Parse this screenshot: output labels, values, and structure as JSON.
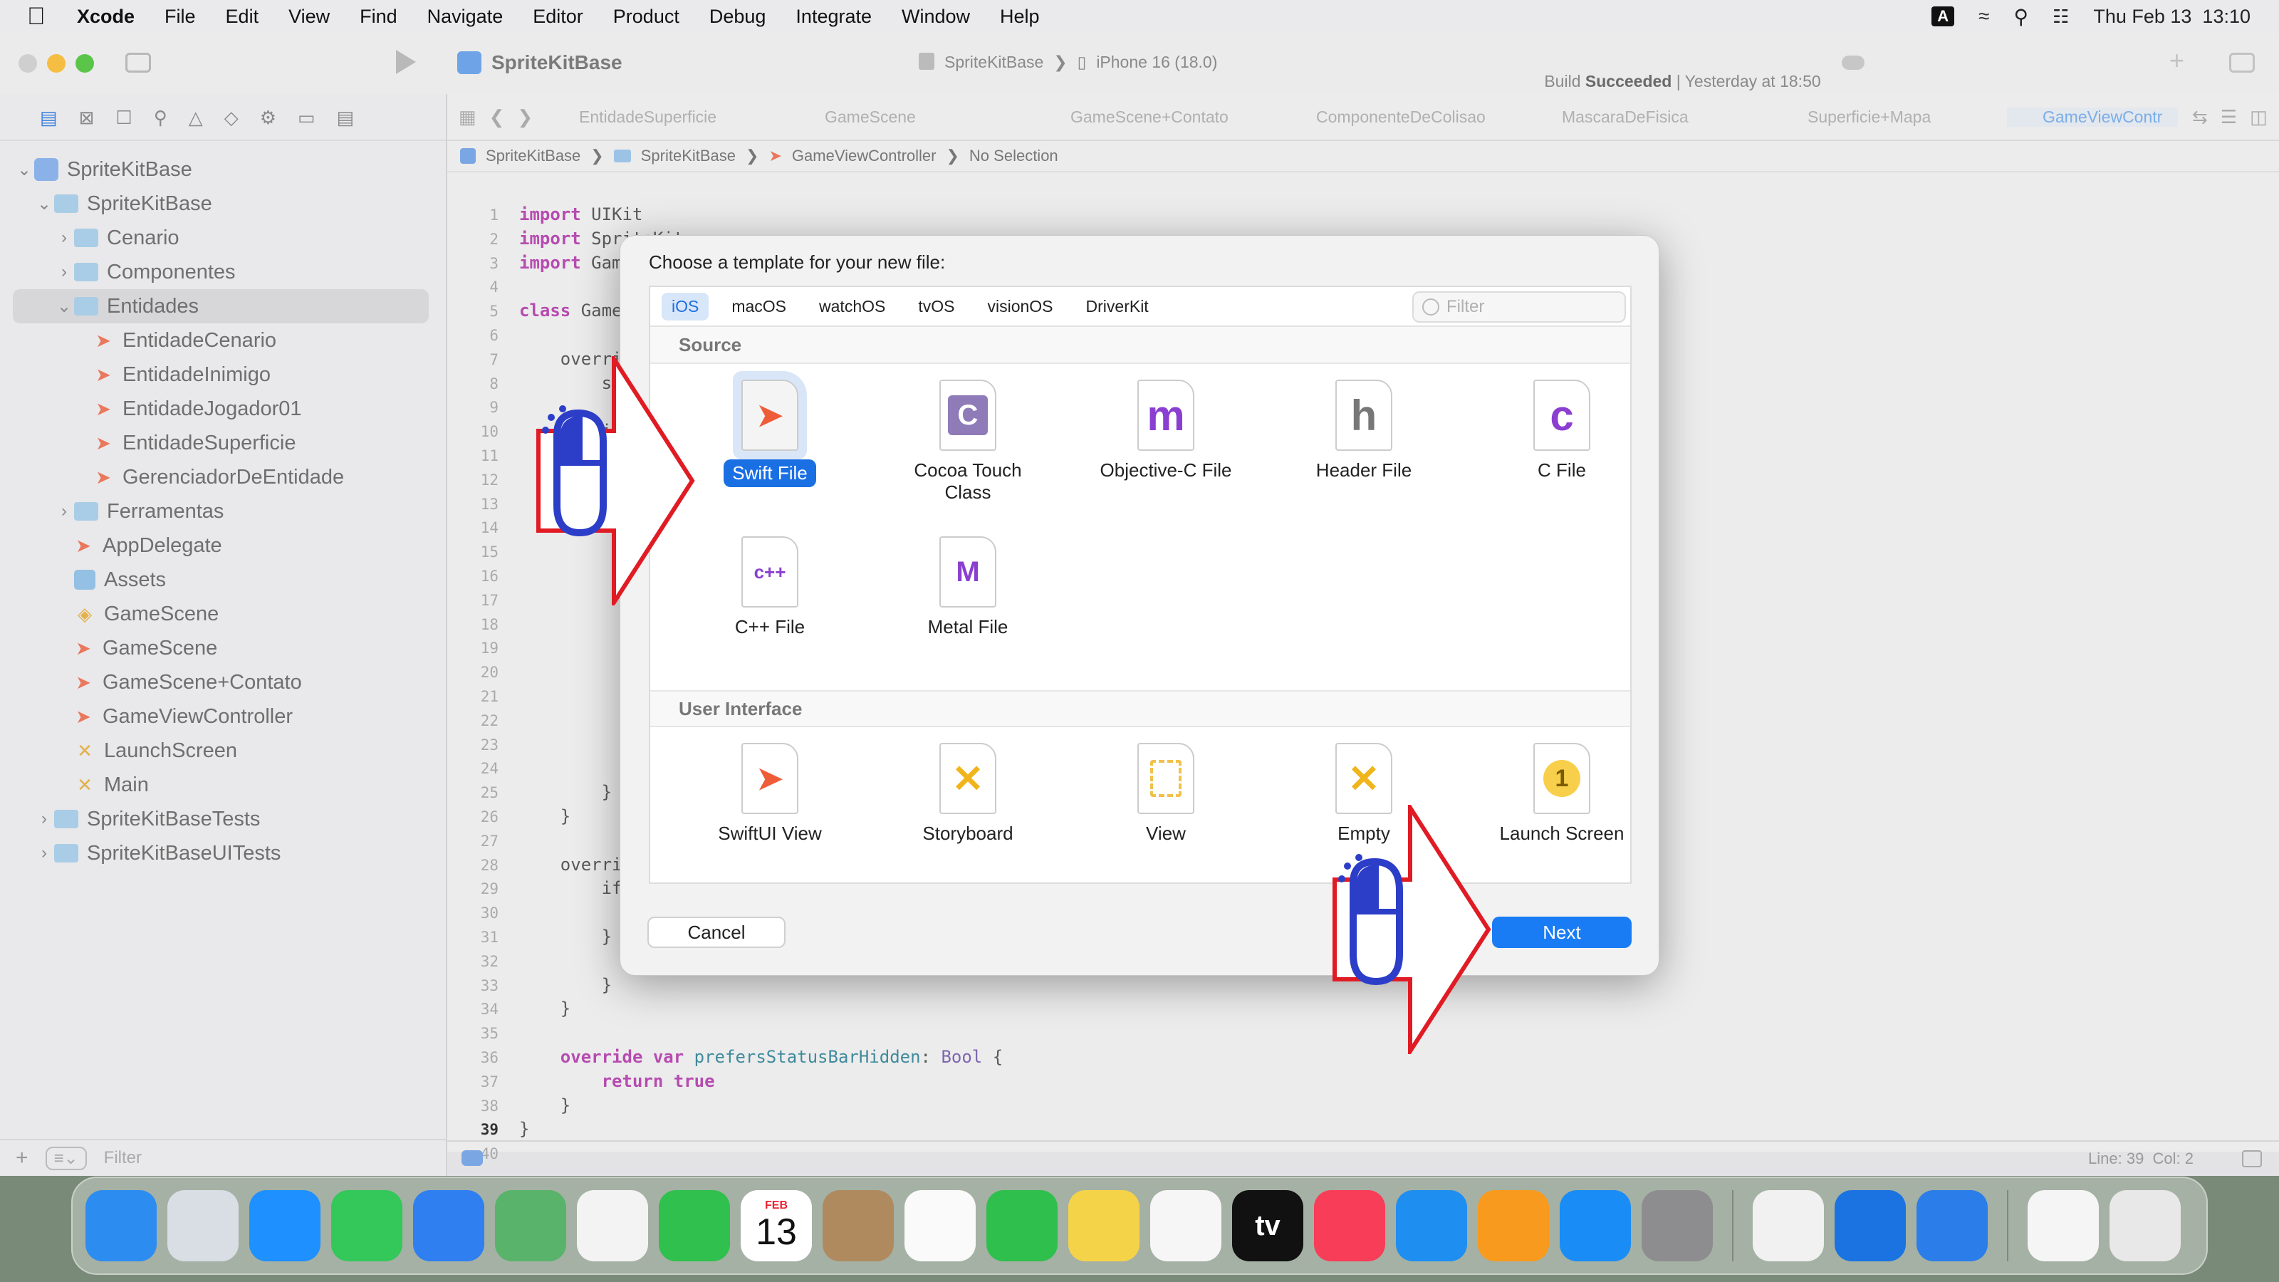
{
  "menubar": {
    "app": "Xcode",
    "items": [
      "File",
      "Edit",
      "View",
      "Find",
      "Navigate",
      "Editor",
      "Product",
      "Debug",
      "Integrate",
      "Window",
      "Help"
    ],
    "input_indicator": "A",
    "clock": "Thu Feb 13  13:10"
  },
  "toolbar": {
    "project": "SpriteKitBase",
    "scheme": "SpriteKitBase",
    "device": "iPhone 16 (18.0)",
    "status_prefix": "Build",
    "status_strong": "Succeeded",
    "status_time": "| Yesterday at 18:50"
  },
  "tabs": [
    "EntidadeSuperficie",
    "GameScene",
    "GameScene+Contato",
    "ComponenteDeColisao",
    "MascaraDeFisica",
    "Superficie+Mapa",
    "GameViewContr"
  ],
  "jumpbar": [
    "SpriteKitBase",
    "SpriteKitBase",
    "GameViewController",
    "No Selection"
  ],
  "navigator": {
    "items": [
      {
        "label": "SpriteKitBase",
        "indent": 0,
        "icon": "project",
        "chev": "⌄"
      },
      {
        "label": "SpriteKitBase",
        "indent": 1,
        "icon": "folder",
        "chev": "⌄"
      },
      {
        "label": "Cenario",
        "indent": 2,
        "icon": "folder",
        "chev": "›"
      },
      {
        "label": "Componentes",
        "indent": 2,
        "icon": "folder",
        "chev": "›"
      },
      {
        "label": "Entidades",
        "indent": 2,
        "icon": "folder",
        "chev": "⌄",
        "selected": true
      },
      {
        "label": "EntidadeCenario",
        "indent": 3,
        "icon": "swift"
      },
      {
        "label": "EntidadeInimigo",
        "indent": 3,
        "icon": "swift"
      },
      {
        "label": "EntidadeJogador01",
        "indent": 3,
        "icon": "swift"
      },
      {
        "label": "EntidadeSuperficie",
        "indent": 3,
        "icon": "swift"
      },
      {
        "label": "GerenciadorDeEntidade",
        "indent": 3,
        "icon": "swift"
      },
      {
        "label": "Ferramentas",
        "indent": 2,
        "icon": "folder",
        "chev": "›"
      },
      {
        "label": "AppDelegate",
        "indent": 2,
        "icon": "swift"
      },
      {
        "label": "Assets",
        "indent": 2,
        "icon": "assets"
      },
      {
        "label": "GameScene",
        "indent": 2,
        "icon": "scene"
      },
      {
        "label": "GameScene",
        "indent": 2,
        "icon": "swift"
      },
      {
        "label": "GameScene+Contato",
        "indent": 2,
        "icon": "swift"
      },
      {
        "label": "GameViewController",
        "indent": 2,
        "icon": "swift"
      },
      {
        "label": "LaunchScreen",
        "indent": 2,
        "icon": "storyboard"
      },
      {
        "label": "Main",
        "indent": 2,
        "icon": "storyboard"
      },
      {
        "label": "SpriteKitBaseTests",
        "indent": 1,
        "icon": "folder",
        "chev": "›"
      },
      {
        "label": "SpriteKitBaseUITests",
        "indent": 1,
        "icon": "folder",
        "chev": "›"
      }
    ],
    "filter_placeholder": "Filter"
  },
  "code": {
    "lines": [
      {
        "n": "1",
        "t": "import UIKit"
      },
      {
        "n": "2",
        "t": "import SpriteKit"
      },
      {
        "n": "3",
        "t": "import GameplayKit"
      },
      {
        "n": "4",
        "t": ""
      },
      {
        "n": "5",
        "t": "class Game"
      },
      {
        "n": "6",
        "t": ""
      },
      {
        "n": "7",
        "t": "    overri"
      },
      {
        "n": "8",
        "t": "        s"
      },
      {
        "n": "9",
        "t": ""
      },
      {
        "n": "10",
        "t": "        i"
      },
      {
        "n": "11",
        "t": ""
      },
      {
        "n": "12",
        "t": ""
      },
      {
        "n": "13",
        "t": ""
      },
      {
        "n": "14",
        "t": ""
      },
      {
        "n": "15",
        "t": ""
      },
      {
        "n": "16",
        "t": ""
      },
      {
        "n": "17",
        "t": ""
      },
      {
        "n": "18",
        "t": ""
      },
      {
        "n": "19",
        "t": ""
      },
      {
        "n": "20",
        "t": ""
      },
      {
        "n": "21",
        "t": ""
      },
      {
        "n": "22",
        "t": ""
      },
      {
        "n": "23",
        "t": ""
      },
      {
        "n": "24",
        "t": ""
      },
      {
        "n": "25",
        "t": "        }"
      },
      {
        "n": "26",
        "t": "    }"
      },
      {
        "n": "27",
        "t": ""
      },
      {
        "n": "28",
        "t": "    overri"
      },
      {
        "n": "29",
        "t": "        if"
      },
      {
        "n": "30",
        "t": ""
      },
      {
        "n": "31",
        "t": "        }"
      },
      {
        "n": "32",
        "t": ""
      },
      {
        "n": "33",
        "t": "        }"
      },
      {
        "n": "34",
        "t": "    }"
      },
      {
        "n": "35",
        "t": ""
      },
      {
        "n": "36",
        "t": "    override var prefersStatusBarHidden: Bool {"
      },
      {
        "n": "37",
        "t": "        return true"
      },
      {
        "n": "38",
        "t": "    }"
      },
      {
        "n": "39",
        "t": "}"
      },
      {
        "n": "40",
        "t": ""
      }
    ],
    "current_line": "39"
  },
  "status": {
    "position": "Line: 39  Col: 2"
  },
  "dialog": {
    "title": "Choose a template for your new file:",
    "platforms": [
      "iOS",
      "macOS",
      "watchOS",
      "tvOS",
      "visionOS",
      "DriverKit"
    ],
    "active_platform": "iOS",
    "filter_placeholder": "Filter",
    "source_header": "Source",
    "ui_header": "User Interface",
    "source_items": [
      {
        "label": "Swift File",
        "icon": "swift-file-icon",
        "glyph": "SWIFT",
        "selected": true
      },
      {
        "label": "Cocoa Touch Class",
        "icon": "cocoa-touch-class-icon",
        "glyph": "C"
      },
      {
        "label": "Objective-C File",
        "icon": "objective-c-file-icon",
        "glyph": "m"
      },
      {
        "label": "Header File",
        "icon": "header-file-icon",
        "glyph": "h"
      },
      {
        "label": "C File",
        "icon": "c-file-icon",
        "glyph": "c"
      },
      {
        "label": "C++ File",
        "icon": "cpp-file-icon",
        "glyph": "c++"
      },
      {
        "label": "Metal File",
        "icon": "metal-file-icon",
        "glyph": "METAL"
      }
    ],
    "ui_items": [
      {
        "label": "SwiftUI View",
        "icon": "swiftui-view-icon",
        "glyph": "SWIFT"
      },
      {
        "label": "Storyboard",
        "icon": "storyboard-icon",
        "glyph": "STORYBOARD"
      },
      {
        "label": "View",
        "icon": "view-icon",
        "glyph": ""
      },
      {
        "label": "Empty",
        "icon": "empty-xib-icon",
        "glyph": "XIB"
      },
      {
        "label": "Launch Screen",
        "icon": "launch-screen-icon",
        "glyph": "1"
      }
    ],
    "cancel": "Cancel",
    "next": "Next"
  },
  "dock": {
    "apps": [
      {
        "name": "finder",
        "color": "#2d8cf0"
      },
      {
        "name": "launchpad",
        "color": "#d9dde4"
      },
      {
        "name": "safari",
        "color": "#1e90ff"
      },
      {
        "name": "messages",
        "color": "#34c759"
      },
      {
        "name": "mail",
        "color": "#2f7ff1"
      },
      {
        "name": "maps",
        "color": "#59b36a"
      },
      {
        "name": "photos",
        "color": "#f3f3f3"
      },
      {
        "name": "facetime",
        "color": "#2fc04e"
      },
      {
        "name": "calendar",
        "color": "#ffffff",
        "month": "FEB",
        "day": "13"
      },
      {
        "name": "contacts",
        "color": "#b08a5f"
      },
      {
        "name": "reminders",
        "color": "#fafafa"
      },
      {
        "name": "numbers",
        "color": "#2fbf4d"
      },
      {
        "name": "notes",
        "color": "#f5d349"
      },
      {
        "name": "freeform",
        "color": "#f6f6f6"
      },
      {
        "name": "tv",
        "color": "#111111",
        "label": "tv"
      },
      {
        "name": "music",
        "color": "#f73d58"
      },
      {
        "name": "keynote",
        "color": "#1f8ef1"
      },
      {
        "name": "pages",
        "color": "#f79a1e"
      },
      {
        "name": "app-store",
        "color": "#1a8cf5"
      },
      {
        "name": "system-settings",
        "color": "#8d8d8f"
      },
      {
        "name": "textedit",
        "color": "#f1f1f1"
      },
      {
        "name": "xcode",
        "color": "#1a73e0"
      },
      {
        "name": "simulator",
        "color": "#2b7de9"
      },
      {
        "name": "weather",
        "color": "#f5f5f5"
      },
      {
        "name": "trash",
        "color": "#e8e8e8"
      }
    ]
  },
  "colors": {
    "accent": "#1a7cf5",
    "arrow": "#e01b24",
    "mouse": "#2c3ec8"
  }
}
